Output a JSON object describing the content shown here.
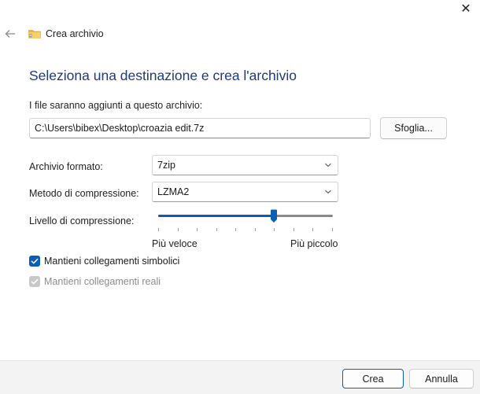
{
  "window": {
    "title": "Crea archivio",
    "close_glyph": "✕",
    "back_icon": "arrow-left-icon",
    "app_icon": "archive-folder-icon"
  },
  "heading": "Seleziona una destinazione e crea l'archivio",
  "destination": {
    "label": "I file saranno aggiunti a questo archivio:",
    "value": "C:\\Users\\bibex\\Desktop\\croazia edit.7z",
    "browse_label": "Sfoglia..."
  },
  "format": {
    "label": "Archivio formato:",
    "value": "7zip"
  },
  "method": {
    "label": "Metodo di compressione:",
    "value": "LZMA2"
  },
  "level": {
    "label": "Livello di compressione:",
    "left_label": "Più veloce",
    "right_label": "Più piccolo",
    "value": 0.66,
    "tick_count": 10
  },
  "options": {
    "symlinks": {
      "label": "Mantieni collegamenti simbolici",
      "checked": true,
      "enabled": true
    },
    "hardlinks": {
      "label": "Mantieni collegamenti reali",
      "checked": true,
      "enabled": false
    }
  },
  "buttons": {
    "create": "Crea",
    "cancel": "Annulla"
  },
  "colors": {
    "accent": "#0a5fb4",
    "heading": "#1f3a78",
    "footer_bg": "#f3f3f3"
  }
}
